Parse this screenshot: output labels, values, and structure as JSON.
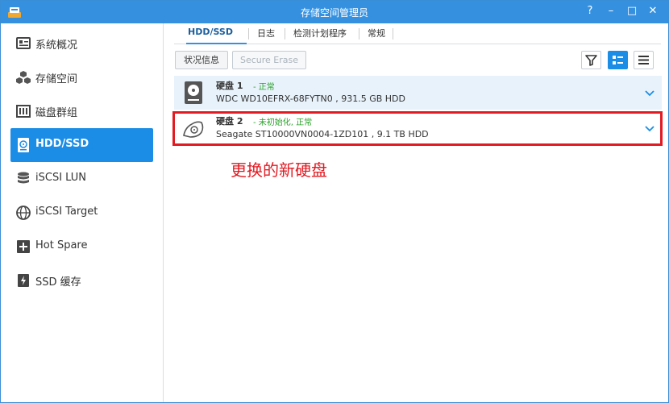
{
  "window": {
    "title": "存储空间管理员",
    "help_label": "?",
    "minimize_label": "–",
    "maximize_label": "□",
    "close_label": "✕"
  },
  "sidebar": {
    "items": [
      {
        "label": "系统概况",
        "icon": "overview-icon"
      },
      {
        "label": "存储空间",
        "icon": "cubes-icon"
      },
      {
        "label": "磁盘群组",
        "icon": "disk-group-icon"
      },
      {
        "label": "HDD/SSD",
        "icon": "hdd-icon",
        "active": true
      },
      {
        "label": "iSCSI LUN",
        "icon": "database-icon"
      },
      {
        "label": "iSCSI Target",
        "icon": "globe-icon"
      },
      {
        "label": "Hot Spare",
        "icon": "hot-spare-icon"
      },
      {
        "label": "SSD 缓存",
        "icon": "ssd-cache-icon"
      }
    ]
  },
  "tabs": [
    {
      "label": "HDD/SSD",
      "active": true
    },
    {
      "label": "日志"
    },
    {
      "label": "检测计划程序"
    },
    {
      "label": "常规"
    }
  ],
  "toolbar": {
    "status_info_label": "状况信息",
    "secure_erase_label": "Secure Erase"
  },
  "disks": [
    {
      "name": "硬盘 1",
      "status": "- 正常",
      "model": "WDC WD10EFRX-68FYTN0 , 931.5 GB HDD"
    },
    {
      "name": "硬盘 2",
      "status": "- 未初始化, 正常",
      "model": "Seagate ST10000VN0004-1ZD101 , 9.1 TB HDD"
    }
  ],
  "annotation": "更换的新硬盘",
  "colors": {
    "titlebar": "#3591e0",
    "active": "#1b8de6",
    "status_ok": "#2aa02a",
    "highlight": "#e21b23"
  }
}
